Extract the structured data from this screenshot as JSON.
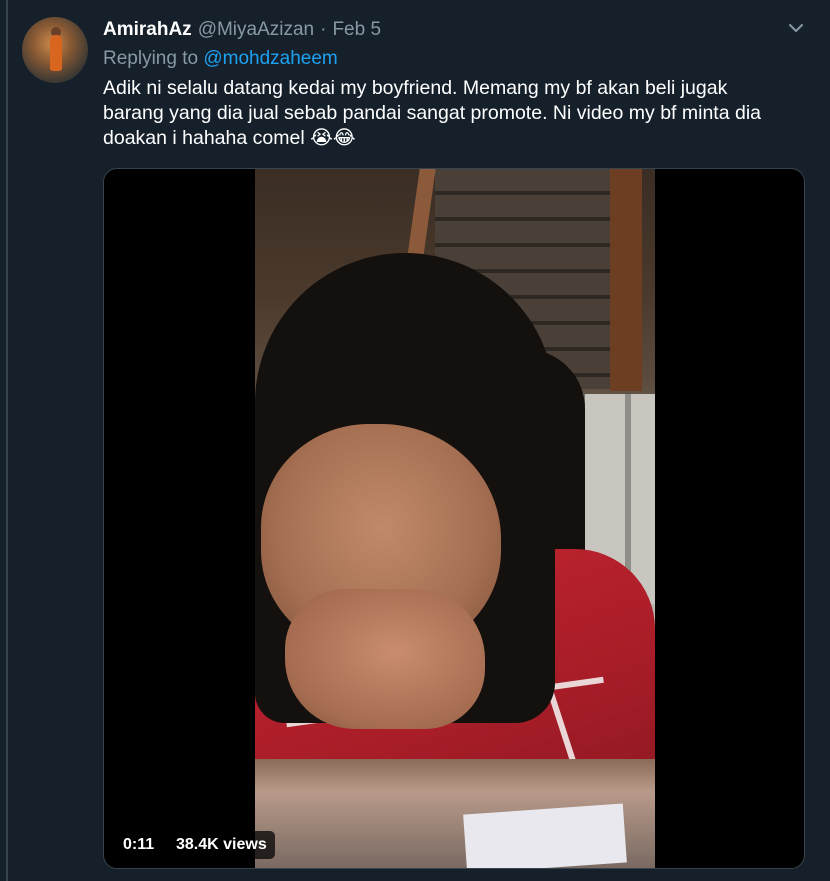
{
  "tweet": {
    "display_name": "AmirahAz",
    "handle": "@MiyaAzizan",
    "separator": "·",
    "date": "Feb 5",
    "replying_prefix": "Replying to",
    "replying_to": "@mohdzaheem",
    "text_lines": [
      "Adik ni selalu datang kedai my boyfriend. Memang my bf akan beli jugak",
      "barang yang dia jual sebab pandai sangat promote. Ni video my bf minta dia",
      "doakan i hahaha comel 😭😂"
    ]
  },
  "video": {
    "duration": "0:11",
    "views": "38.4K views"
  },
  "icons": {
    "menu": "chevron-down-icon",
    "avatar": "avatar"
  },
  "colors": {
    "background": "#15202b",
    "text_primary": "#ffffff",
    "text_secondary": "#8899a6",
    "link": "#1da1f2",
    "border": "#38444d"
  }
}
